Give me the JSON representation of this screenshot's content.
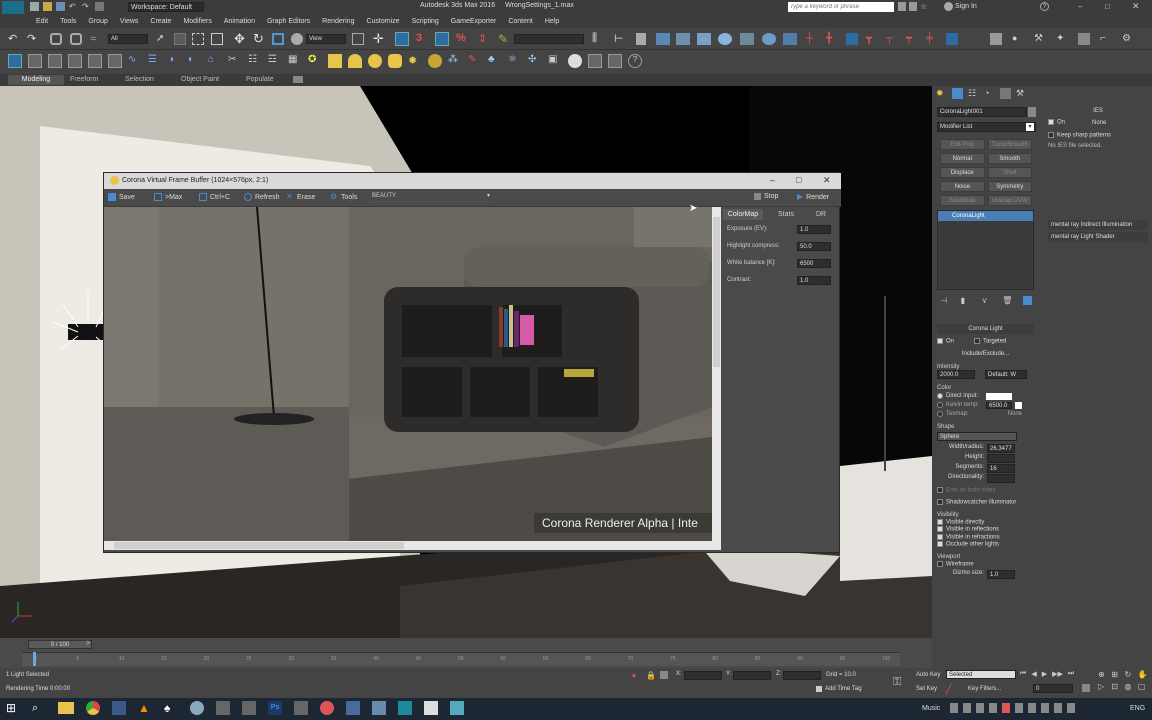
{
  "window": {
    "workspace": "Workspace: Default",
    "title": "Autodesk 3ds Max 2016",
    "file": "WrongSettings_1.max",
    "search_placeholder": "Type a keyword or phrase",
    "sign_in": "Sign In"
  },
  "menu": [
    "Edit",
    "Tools",
    "Group",
    "Views",
    "Create",
    "Modifiers",
    "Animation",
    "Graph Editors",
    "Rendering",
    "Customize",
    "Scripting",
    "GameExporter",
    "Content",
    "Help"
  ],
  "toolbar": {
    "selection_filter": "All",
    "ref_coord": "View"
  },
  "ribbon_tabs": [
    "Modeling",
    "Freeform",
    "Selection",
    "Object Paint",
    "Populate"
  ],
  "vfb": {
    "title": "Corona Virtual Frame Buffer (1024×576px, 2:1)",
    "buttons": [
      "Save",
      ">Max",
      "Ctrl+C",
      "Refresh",
      "Erase",
      "Tools"
    ],
    "channel": "BEAUTY",
    "stop": "Stop",
    "render": "Render",
    "watermark": "Corona Renderer Alpha | Inte",
    "tabs": [
      "ColorMap",
      "Stats",
      "DR"
    ],
    "colormap": [
      {
        "label": "Exposure (EV):",
        "value": "1.0"
      },
      {
        "label": "Highlight compress:",
        "value": "50.0"
      },
      {
        "label": "White balance [K]:",
        "value": "6500"
      },
      {
        "label": "Contrast:",
        "value": "1.0"
      }
    ]
  },
  "cmd": {
    "object_name": "CoronaLight001",
    "modifier_list": "Modifier List",
    "mod_buttons": [
      {
        "label": "Edit Poly",
        "dim": true
      },
      {
        "label": "TurboSmooth",
        "dim": true
      },
      {
        "label": "Normal",
        "dim": false
      },
      {
        "label": "Smooth",
        "dim": false
      },
      {
        "label": "Displace",
        "dim": false
      },
      {
        "label": "Shell",
        "dim": true
      },
      {
        "label": "Noise",
        "dim": false
      },
      {
        "label": "Symmetry",
        "dim": false
      },
      {
        "label": "Substitute",
        "dim": true
      },
      {
        "label": "Unwrap UVW",
        "dim": true
      }
    ],
    "stack_item": "CoronaLight",
    "ies": {
      "title": "IES",
      "on": "On",
      "none": "None",
      "keep_sharp": "Keep sharp patterns",
      "no_file": "No IES file selected."
    },
    "mental_ray": [
      "mental ray Indirect Illumination",
      "mental ray Light Shader"
    ],
    "corona_light": {
      "title": "Corona Light",
      "on": "On",
      "targeted": "Targeted",
      "include_exclude": "Include/Exclude...",
      "intensity_label": "Intensity",
      "intensity": "2000.0",
      "intensity_unit": "Default: W",
      "color_label": "Color",
      "direct_input": "Direct input:",
      "kelvin_temp": "Kelvin temp:",
      "kelvin_value": "6500.0",
      "texmap": "Texmap:",
      "texmap_value": "None",
      "shape_label": "Shape",
      "shape": "Sphere",
      "width_radius": "Width/radius:",
      "width_radius_value": "26.3477",
      "height": "Height:",
      "segments": "Segments:",
      "segments_value": "16",
      "directionality": "Directionality:",
      "emit_both": "Emit on both sides",
      "shadowcatcher": "Shadowcatcher illuminator",
      "visibility_label": "Visibility",
      "visible_directly": "Visible directly",
      "visible_reflections": "Visible in reflections",
      "visible_refractions": "Visible in refractions",
      "occlude": "Occlude other lights",
      "viewport_label": "Viewport",
      "wireframe": "Wireframe",
      "gizmo_size": "Gizmo size:",
      "gizmo_value": "1.0"
    }
  },
  "timeline": {
    "frame": "0 / 100",
    "ticks": [
      "0",
      "5",
      "10",
      "15",
      "20",
      "25",
      "30",
      "35",
      "40",
      "45",
      "50",
      "55",
      "60",
      "65",
      "70",
      "75",
      "80",
      "85",
      "90",
      "95",
      "100"
    ]
  },
  "status": {
    "selected": "1 Light Selected",
    "render_time": "Rendering Time 0:00:00",
    "x_label": "X:",
    "y_label": "Y:",
    "z_label": "Z:",
    "grid": "Grid = 10.0",
    "add_time_tag": "Add Time Tag",
    "auto_key": "Auto Key",
    "auto_key_mode": "Selected",
    "set_key": "Set Key",
    "key_filters": "Key Filters...",
    "frame_value": "0"
  },
  "taskbar": {
    "music": "Music",
    "lang": "ENG"
  }
}
